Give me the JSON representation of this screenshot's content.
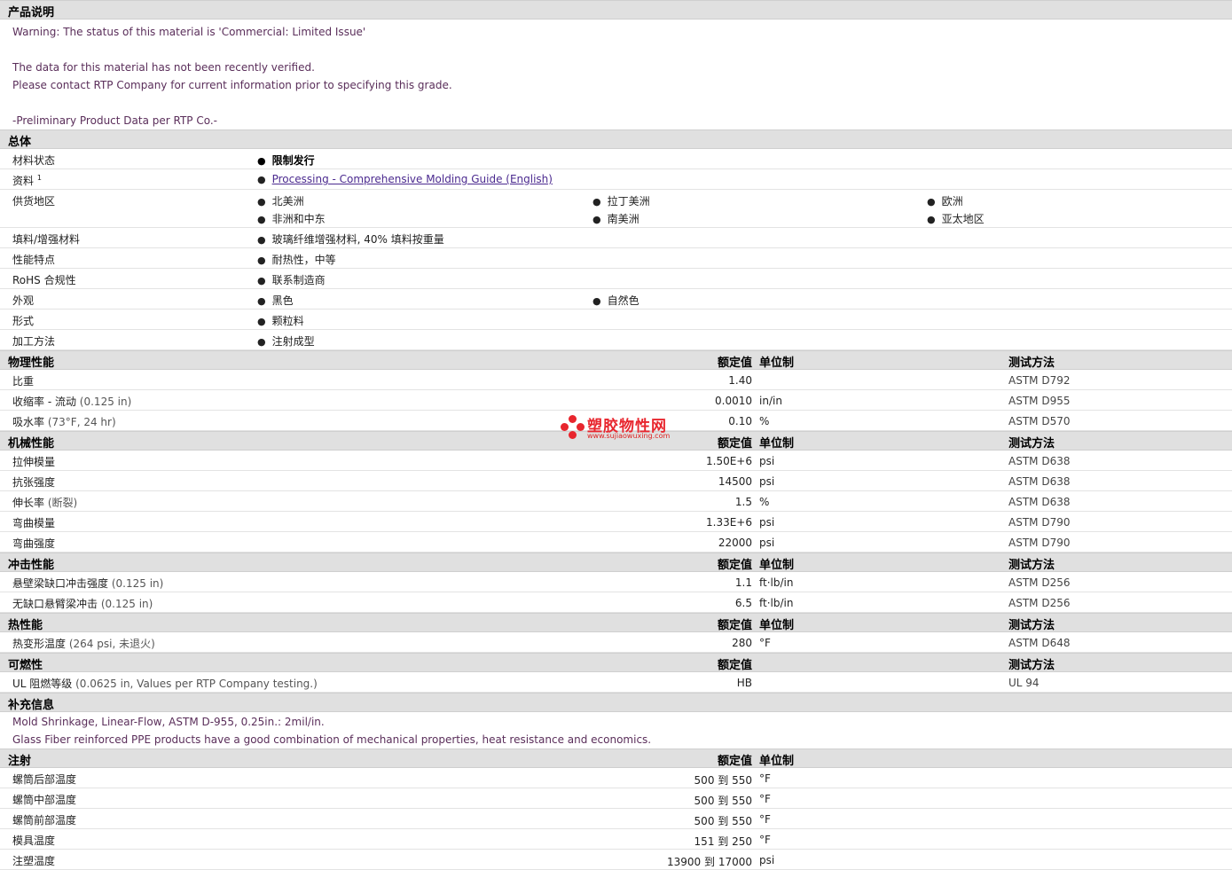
{
  "description": {
    "header": "产品说明",
    "lines": [
      "Warning: The status of this material is 'Commercial: Limited Issue'",
      "",
      "The data for this material has not been recently verified.",
      "Please contact RTP Company for current information prior to specifying this grade.",
      "",
      "-Preliminary Product Data per RTP Co.-"
    ]
  },
  "general": {
    "header": "总体",
    "rows": [
      {
        "label": "材料状态",
        "items": [
          "限制发行"
        ]
      },
      {
        "label": "资料",
        "sup": "1",
        "items": [
          "Processing - Comprehensive Molding Guide (English)"
        ]
      },
      {
        "label": "供货地区",
        "items": [
          "北美洲",
          "拉丁美洲",
          "欧洲",
          "非洲和中东",
          "南美洲",
          "亚太地区"
        ]
      },
      {
        "label": "填料/增强材料",
        "items": [
          "玻璃纤维增强材料, 40% 填料按重量"
        ]
      },
      {
        "label": "性能特点",
        "items": [
          "耐热性，中等"
        ]
      },
      {
        "label": "RoHS 合规性",
        "items": [
          "联系制造商"
        ]
      },
      {
        "label": "外观",
        "items": [
          "黑色",
          "自然色"
        ]
      },
      {
        "label": "形式",
        "items": [
          "颗粒料"
        ]
      },
      {
        "label": "加工方法",
        "items": [
          "注射成型"
        ]
      }
    ]
  },
  "columns": {
    "value": "额定值",
    "unit": "单位制",
    "method": "测试方法"
  },
  "physical": {
    "header": "物理性能",
    "rows": [
      {
        "label": "比重",
        "value": "1.40",
        "unit": "",
        "method": "ASTM D792"
      },
      {
        "label": "收缩率 - 流动",
        "cond": "(0.125 in)",
        "value": "0.0010",
        "unit": "in/in",
        "method": "ASTM D955"
      },
      {
        "label": "吸水率",
        "cond": "(73°F, 24 hr)",
        "value": "0.10",
        "unit": "%",
        "method": "ASTM D570"
      }
    ]
  },
  "mechanical": {
    "header": "机械性能",
    "rows": [
      {
        "label": "拉伸模量",
        "value": "1.50E+6",
        "unit": "psi",
        "method": "ASTM D638"
      },
      {
        "label": "抗张强度",
        "value": "14500",
        "unit": "psi",
        "method": "ASTM D638"
      },
      {
        "label": "伸长率",
        "cond": "(断裂)",
        "value": "1.5",
        "unit": "%",
        "method": "ASTM D638"
      },
      {
        "label": "弯曲模量",
        "value": "1.33E+6",
        "unit": "psi",
        "method": "ASTM D790"
      },
      {
        "label": "弯曲强度",
        "value": "22000",
        "unit": "psi",
        "method": "ASTM D790"
      }
    ]
  },
  "impact": {
    "header": "冲击性能",
    "rows": [
      {
        "label": "悬壁梁缺口冲击强度",
        "cond": "(0.125 in)",
        "value": "1.1",
        "unit": "ft·lb/in",
        "method": "ASTM D256"
      },
      {
        "label": "无缺口悬臂梁冲击",
        "cond": "(0.125 in)",
        "value": "6.5",
        "unit": "ft·lb/in",
        "method": "ASTM D256"
      }
    ]
  },
  "thermal": {
    "header": "热性能",
    "rows": [
      {
        "label": "热变形温度",
        "cond": "(264 psi, 未退火)",
        "value": "280",
        "unit": "°F",
        "method": "ASTM D648"
      }
    ]
  },
  "flammability": {
    "header": "可燃性",
    "rows": [
      {
        "label": "UL 阻燃等级",
        "cond": "(0.0625 in, Values per RTP Company testing.)",
        "value": "HB",
        "unit": "",
        "method": "UL 94"
      }
    ]
  },
  "supplemental": {
    "header": "补充信息",
    "lines": [
      "Mold Shrinkage, Linear-Flow, ASTM D-955, 0.25in.: 2mil/in.",
      "Glass Fiber reinforced PPE products have a good combination of mechanical properties, heat resistance and economics."
    ]
  },
  "injection": {
    "header": "注射",
    "rows": [
      {
        "label": "螺筒后部温度",
        "value": "500 到  550",
        "unit": "°F"
      },
      {
        "label": "螺筒中部温度",
        "value": "500 到  550",
        "unit": "°F"
      },
      {
        "label": "螺筒前部温度",
        "value": "500 到  550",
        "unit": "°F"
      },
      {
        "label": "模具温度",
        "value": "151 到  250",
        "unit": "°F"
      },
      {
        "label": "注塑温度",
        "value": "13900 到  17000",
        "unit": "psi"
      }
    ]
  },
  "watermark": {
    "name": "塑胶物性网",
    "url": "www.sujiaowuxing.com",
    "color": "#e8262e"
  }
}
